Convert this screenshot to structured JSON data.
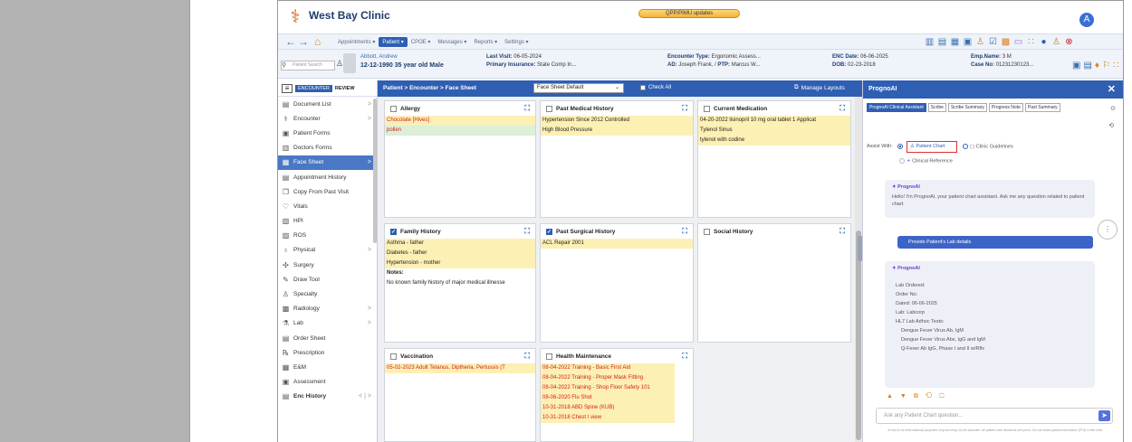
{
  "header": {
    "clinic_name": "West Bay Clinic",
    "updates_label": "QPP/PIMU updates",
    "avatar_letter": "A"
  },
  "nav": {
    "items": [
      "Appointments ▾",
      "Patient ▾",
      "CPOE ▾",
      "Messages ▾",
      "Reports ▾",
      "Settings ▾"
    ],
    "active_index": 1,
    "tool_icons": [
      "▥",
      "▤",
      "▦",
      "▣",
      "♙",
      "☑",
      "▩",
      "▭",
      "∷",
      "●",
      "♙",
      "⊗"
    ]
  },
  "patient": {
    "search_placeholder": "Patient Search",
    "name": "Abbott, Andrew",
    "demographics": "12-12-1990 35 year old Male",
    "last_visit_label": "Last Visit:",
    "last_visit": "06-05-2024",
    "insurance_label": "Primary Insurance:",
    "insurance": "State Comp In...",
    "encounter_type_label": "Encounter Type:",
    "encounter_type": "Ergonomic Assess...",
    "ad_label": "AD:",
    "ad": "Joseph Frank, /",
    "ptp_label": "PTP:",
    "ptp": "Marcus W...",
    "enc_date_label": "ENC Date:",
    "enc_date": "06-06-2025",
    "dob_label": "DOB:",
    "dob": "02-23-2018",
    "emp_name_label": "Emp.Name:",
    "emp_name": "3 M",
    "case_no_label": "Case No:",
    "case_no": "01231230123..."
  },
  "sidebar": {
    "encounter_btn": "ENCOUNTER",
    "review_btn": "REVIEW",
    "items": [
      {
        "label": "Document List",
        "icon": "▤",
        "chev": ">"
      },
      {
        "label": "Encounter",
        "icon": "⚕",
        "chev": ">"
      },
      {
        "label": "Patient Forms",
        "icon": "▣",
        "chev": ""
      },
      {
        "label": "Doctors Forms",
        "icon": "▥",
        "chev": ""
      },
      {
        "label": "Face Sheet",
        "icon": "▦",
        "chev": ">"
      },
      {
        "label": "Appointment History",
        "icon": "▤",
        "chev": ""
      },
      {
        "label": "Copy From Past Visit",
        "icon": "❐",
        "chev": ""
      },
      {
        "label": "Vitals",
        "icon": "♡",
        "chev": ""
      },
      {
        "label": "HPI",
        "icon": "▧",
        "chev": ""
      },
      {
        "label": "ROS",
        "icon": "▨",
        "chev": ""
      },
      {
        "label": "Physical",
        "icon": "♁",
        "chev": ">"
      },
      {
        "label": "Surgery",
        "icon": "✣",
        "chev": ""
      },
      {
        "label": "Draw Tool",
        "icon": "✎",
        "chev": ""
      },
      {
        "label": "Specialty",
        "icon": "♙",
        "chev": ""
      },
      {
        "label": "Radiology",
        "icon": "▩",
        "chev": ">"
      },
      {
        "label": "Lab",
        "icon": "⚗",
        "chev": ">"
      },
      {
        "label": "Order Sheet",
        "icon": "▤",
        "chev": ""
      },
      {
        "label": "Prescription",
        "icon": "℞",
        "chev": ""
      },
      {
        "label": "E&M",
        "icon": "▦",
        "chev": ""
      },
      {
        "label": "Assessment",
        "icon": "▣",
        "chev": ""
      },
      {
        "label": "Enc History",
        "icon": "▤",
        "chev": "< | >"
      }
    ],
    "active_index": 4
  },
  "content": {
    "breadcrumb": "Patient  >  Encounter  >  Face Sheet",
    "facesheet_select": "Face Sheet Default",
    "check_all": "Check All",
    "manage_layouts": "Manage Layouts",
    "cards": {
      "allergy": {
        "title": "Allergy",
        "rows": [
          "Chocolate [Hives]",
          "pollen"
        ]
      },
      "pmh": {
        "title": "Past Medical History",
        "rows": [
          "Hypertension Since 2012 Controlled",
          "High Blood Pressure"
        ]
      },
      "medication": {
        "title": "Current Medication",
        "rows": [
          "04-20-2022 lisinopril 10 mg oral tablet 1 Applicat",
          "Tylenol Sinus",
          "tylenol with codine"
        ]
      },
      "family": {
        "title": "Family History",
        "rows": [
          "Asthma - father",
          "Diabetes - father",
          "Hypertension - mother",
          "Notes:",
          "No known family history of major medical illnesse"
        ]
      },
      "surgical": {
        "title": "Past Surgical History",
        "rows": [
          "ACL Repair 2001"
        ]
      },
      "social": {
        "title": "Social History",
        "rows": []
      },
      "vaccination": {
        "title": "Vaccination",
        "rows": [
          "05-02-2023 Adult Tetanus, Diptheria, Pertussis (T"
        ]
      },
      "health": {
        "title": "Health Maintenance",
        "rows": [
          "08-04-2022 Training - Basic First Aid",
          "08-04-2022 Training - Proper Mask Fitting",
          "08-04-2022 Training - Shop Floor Safety 101",
          "08-06-2020 Flu Shot",
          "10-31-2018 ABD Spine (KUB)",
          "10-31-2018 Chest I view"
        ]
      }
    }
  },
  "ai": {
    "title": "PrognoAI",
    "tabs": [
      "PrognoAI Clinical Assistant",
      "Scribe",
      "Scribe Summary",
      "Progress Note",
      "Past Summary"
    ],
    "assist_with": "Assist With:",
    "patient_chart": "Patient Chart",
    "clinic_guidelines": "Clinic Guidelines",
    "clinical_reference": "Clinical Reference",
    "bot_name": "PrognoAI",
    "greeting": "Hello! I'm PrognoAI, your patient chart assistant. Ask me any question related to patient chart.",
    "user_message": "Provide Patient's Lab details",
    "response_lines": [
      "Lab Ordered:",
      "Order No:",
      "Dated: 06-06-2025",
      "Lab: Labcorp",
      "HL7 Lab Adhoc Tests:",
      "Dengue Fever Virus Ab, IgM",
      "Dengue Fever Virus Abs, IgG and IgM",
      "Q-Fever Ab IgG, Phase I and II w/Rflx"
    ],
    "reactions": "▲ ▼ ⧉ ⟲ ☐",
    "input_placeholder": "Ask any Patient Chart question...",
    "disclaimer": "AI tool is for informational purposes only and may not be accurate. All patient care decisions are yours. Do not share patient information (PHI) in this chat."
  }
}
